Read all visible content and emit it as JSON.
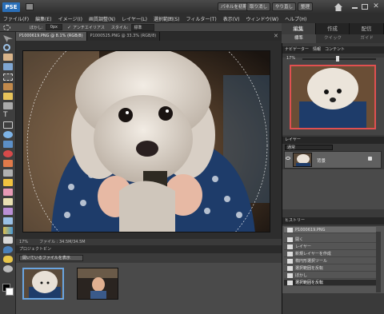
{
  "app": {
    "logo": "PSE",
    "btn_new_file": "パネルを初期化",
    "btn_undo": "取り消し",
    "btn_redo": "やり直し",
    "btn_organizer": "整理",
    "colors": {
      "accent": "#2a6fb8",
      "nav_frame": "#e05050"
    }
  },
  "menu": [
    "ファイル(F)",
    "編集(E)",
    "イメージ(I)",
    "画質調整(N)",
    "レイヤー(L)",
    "選択範囲(S)",
    "フィルター(T)",
    "表示(V)",
    "ウィンドウ(W)",
    "ヘルプ(H)"
  ],
  "options": {
    "feather_label": "ぼかし:",
    "feather_value": "0px",
    "antialias_label": "アンチエイリアス",
    "style_label": "スタイル:",
    "style_value": "標準"
  },
  "doc_tabs": [
    "P1000619.PNG @ 8.1% (RGB/8)",
    "P1000525.PNG @ 33.3% (RGB/8)"
  ],
  "status": {
    "zoom": "17%",
    "doc": "ファイル : 34.5M/34.5M"
  },
  "bin": {
    "title": "プロジェクトビン",
    "select": "開いているファイルを表示"
  },
  "panel": {
    "mode_tabs": [
      "編集",
      "作成",
      "配信"
    ],
    "sub_tabs": [
      "標準",
      "クイック",
      "ガイド"
    ],
    "nav_header": [
      "ナビゲーター",
      "情報",
      "コンテント"
    ],
    "nav_zoom": "17%",
    "layers_header": "レイヤー",
    "blend_mode": "通常",
    "layer_name": "背景",
    "history_header": "ヒストリー",
    "history": [
      "P1000619.PNG",
      "開く",
      "レイヤー",
      "新規レイヤーを作成",
      "楕円形選択ツール",
      "選択範囲を反転",
      "ぼかし",
      "選択範囲を反転"
    ]
  }
}
